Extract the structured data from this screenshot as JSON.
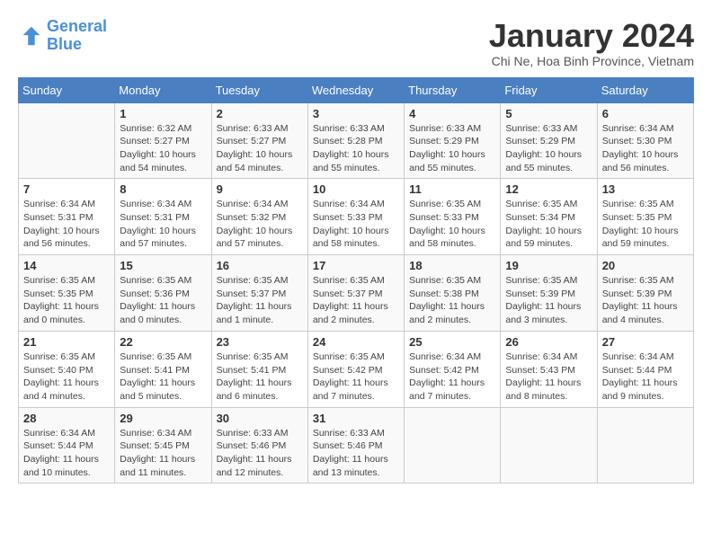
{
  "header": {
    "logo_line1": "General",
    "logo_line2": "Blue",
    "month_year": "January 2024",
    "location": "Chi Ne, Hoa Binh Province, Vietnam"
  },
  "weekdays": [
    "Sunday",
    "Monday",
    "Tuesday",
    "Wednesday",
    "Thursday",
    "Friday",
    "Saturday"
  ],
  "weeks": [
    [
      {
        "day": "",
        "info": ""
      },
      {
        "day": "1",
        "info": "Sunrise: 6:32 AM\nSunset: 5:27 PM\nDaylight: 10 hours\nand 54 minutes."
      },
      {
        "day": "2",
        "info": "Sunrise: 6:33 AM\nSunset: 5:27 PM\nDaylight: 10 hours\nand 54 minutes."
      },
      {
        "day": "3",
        "info": "Sunrise: 6:33 AM\nSunset: 5:28 PM\nDaylight: 10 hours\nand 55 minutes."
      },
      {
        "day": "4",
        "info": "Sunrise: 6:33 AM\nSunset: 5:29 PM\nDaylight: 10 hours\nand 55 minutes."
      },
      {
        "day": "5",
        "info": "Sunrise: 6:33 AM\nSunset: 5:29 PM\nDaylight: 10 hours\nand 55 minutes."
      },
      {
        "day": "6",
        "info": "Sunrise: 6:34 AM\nSunset: 5:30 PM\nDaylight: 10 hours\nand 56 minutes."
      }
    ],
    [
      {
        "day": "7",
        "info": "Sunrise: 6:34 AM\nSunset: 5:31 PM\nDaylight: 10 hours\nand 56 minutes."
      },
      {
        "day": "8",
        "info": "Sunrise: 6:34 AM\nSunset: 5:31 PM\nDaylight: 10 hours\nand 57 minutes."
      },
      {
        "day": "9",
        "info": "Sunrise: 6:34 AM\nSunset: 5:32 PM\nDaylight: 10 hours\nand 57 minutes."
      },
      {
        "day": "10",
        "info": "Sunrise: 6:34 AM\nSunset: 5:33 PM\nDaylight: 10 hours\nand 58 minutes."
      },
      {
        "day": "11",
        "info": "Sunrise: 6:35 AM\nSunset: 5:33 PM\nDaylight: 10 hours\nand 58 minutes."
      },
      {
        "day": "12",
        "info": "Sunrise: 6:35 AM\nSunset: 5:34 PM\nDaylight: 10 hours\nand 59 minutes."
      },
      {
        "day": "13",
        "info": "Sunrise: 6:35 AM\nSunset: 5:35 PM\nDaylight: 10 hours\nand 59 minutes."
      }
    ],
    [
      {
        "day": "14",
        "info": "Sunrise: 6:35 AM\nSunset: 5:35 PM\nDaylight: 11 hours\nand 0 minutes."
      },
      {
        "day": "15",
        "info": "Sunrise: 6:35 AM\nSunset: 5:36 PM\nDaylight: 11 hours\nand 0 minutes."
      },
      {
        "day": "16",
        "info": "Sunrise: 6:35 AM\nSunset: 5:37 PM\nDaylight: 11 hours\nand 1 minute."
      },
      {
        "day": "17",
        "info": "Sunrise: 6:35 AM\nSunset: 5:37 PM\nDaylight: 11 hours\nand 2 minutes."
      },
      {
        "day": "18",
        "info": "Sunrise: 6:35 AM\nSunset: 5:38 PM\nDaylight: 11 hours\nand 2 minutes."
      },
      {
        "day": "19",
        "info": "Sunrise: 6:35 AM\nSunset: 5:39 PM\nDaylight: 11 hours\nand 3 minutes."
      },
      {
        "day": "20",
        "info": "Sunrise: 6:35 AM\nSunset: 5:39 PM\nDaylight: 11 hours\nand 4 minutes."
      }
    ],
    [
      {
        "day": "21",
        "info": "Sunrise: 6:35 AM\nSunset: 5:40 PM\nDaylight: 11 hours\nand 4 minutes."
      },
      {
        "day": "22",
        "info": "Sunrise: 6:35 AM\nSunset: 5:41 PM\nDaylight: 11 hours\nand 5 minutes."
      },
      {
        "day": "23",
        "info": "Sunrise: 6:35 AM\nSunset: 5:41 PM\nDaylight: 11 hours\nand 6 minutes."
      },
      {
        "day": "24",
        "info": "Sunrise: 6:35 AM\nSunset: 5:42 PM\nDaylight: 11 hours\nand 7 minutes."
      },
      {
        "day": "25",
        "info": "Sunrise: 6:34 AM\nSunset: 5:42 PM\nDaylight: 11 hours\nand 7 minutes."
      },
      {
        "day": "26",
        "info": "Sunrise: 6:34 AM\nSunset: 5:43 PM\nDaylight: 11 hours\nand 8 minutes."
      },
      {
        "day": "27",
        "info": "Sunrise: 6:34 AM\nSunset: 5:44 PM\nDaylight: 11 hours\nand 9 minutes."
      }
    ],
    [
      {
        "day": "28",
        "info": "Sunrise: 6:34 AM\nSunset: 5:44 PM\nDaylight: 11 hours\nand 10 minutes."
      },
      {
        "day": "29",
        "info": "Sunrise: 6:34 AM\nSunset: 5:45 PM\nDaylight: 11 hours\nand 11 minutes."
      },
      {
        "day": "30",
        "info": "Sunrise: 6:33 AM\nSunset: 5:46 PM\nDaylight: 11 hours\nand 12 minutes."
      },
      {
        "day": "31",
        "info": "Sunrise: 6:33 AM\nSunset: 5:46 PM\nDaylight: 11 hours\nand 13 minutes."
      },
      {
        "day": "",
        "info": ""
      },
      {
        "day": "",
        "info": ""
      },
      {
        "day": "",
        "info": ""
      }
    ]
  ]
}
